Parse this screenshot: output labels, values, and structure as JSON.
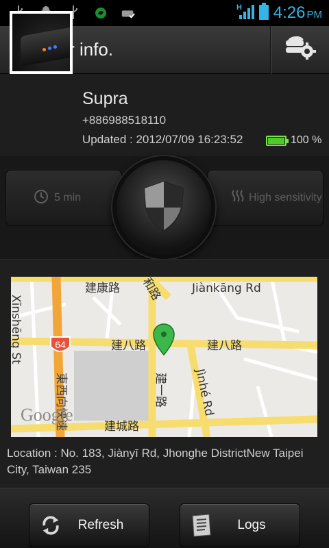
{
  "statusbar": {
    "icons": [
      "usb-icon",
      "android-debug-icon",
      "usb-icon",
      "app-notification-icon",
      "sync-icon"
    ],
    "network": "H",
    "time": "4:26",
    "ampm": "PM"
  },
  "header": {
    "title": "Locator info.",
    "settings_icon": "settings-cloud-gear-icon"
  },
  "device": {
    "name": "Supra",
    "phone": "+886988518110",
    "updated": "Updated : 2012/07/09 16:23:52",
    "battery_text": "100 %",
    "battery_level": 1.0
  },
  "controls": {
    "interval_label": "5 min",
    "sensitivity_label": "High sensitivity"
  },
  "map": {
    "streets": [
      "建康路",
      "Jiànkāng Rd",
      "建八路",
      "建八路",
      "建城路",
      "建一路",
      "Jìnhé Rd",
      "Xīnshēng St",
      "東西向快速",
      "和路"
    ],
    "highway_shield": "64",
    "attribution": "Google"
  },
  "location": {
    "text": "Location : No. 183, Jiànyī Rd, Jhonghe DistrictNew Taipei City, Taiwan 235"
  },
  "buttons": {
    "refresh_label": "Refresh",
    "logs_label": "Logs"
  },
  "colors": {
    "accent": "#33b5e5",
    "battery": "#4ec82a",
    "pin": "#3cb84a"
  }
}
